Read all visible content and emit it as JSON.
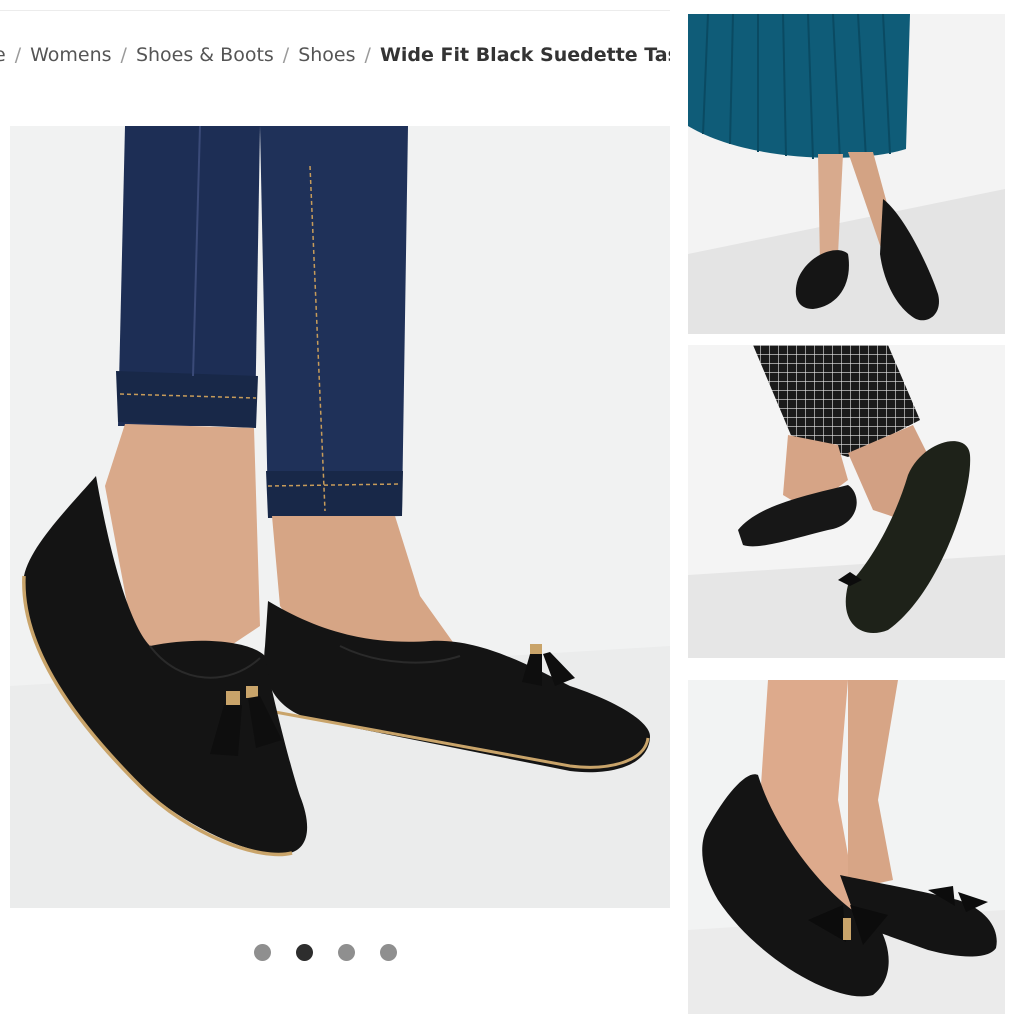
{
  "breadcrumb": {
    "items": [
      "e",
      "Womens",
      "Shoes & Boots",
      "Shoes"
    ],
    "current": "Wide Fit Black Suedette Tassel Loafers",
    "separator": "/"
  },
  "gallery": {
    "main_image": {
      "name": "black-suedette-tassel-loafers",
      "colors": {
        "shoe": "#141414",
        "trim": "#c9a46a",
        "denim": "#1d2e55",
        "skin": "#d9a98a"
      }
    },
    "thumbnails": [
      {
        "name": "black-quilted-ballet-flats-teal-skirt",
        "skirt_color": "#0f5c78"
      },
      {
        "name": "black-woven-ballet-flats-check-trousers"
      },
      {
        "name": "black-suedette-bow-ballet-flats"
      }
    ],
    "dots": {
      "count": 4,
      "active_index": 1
    }
  }
}
